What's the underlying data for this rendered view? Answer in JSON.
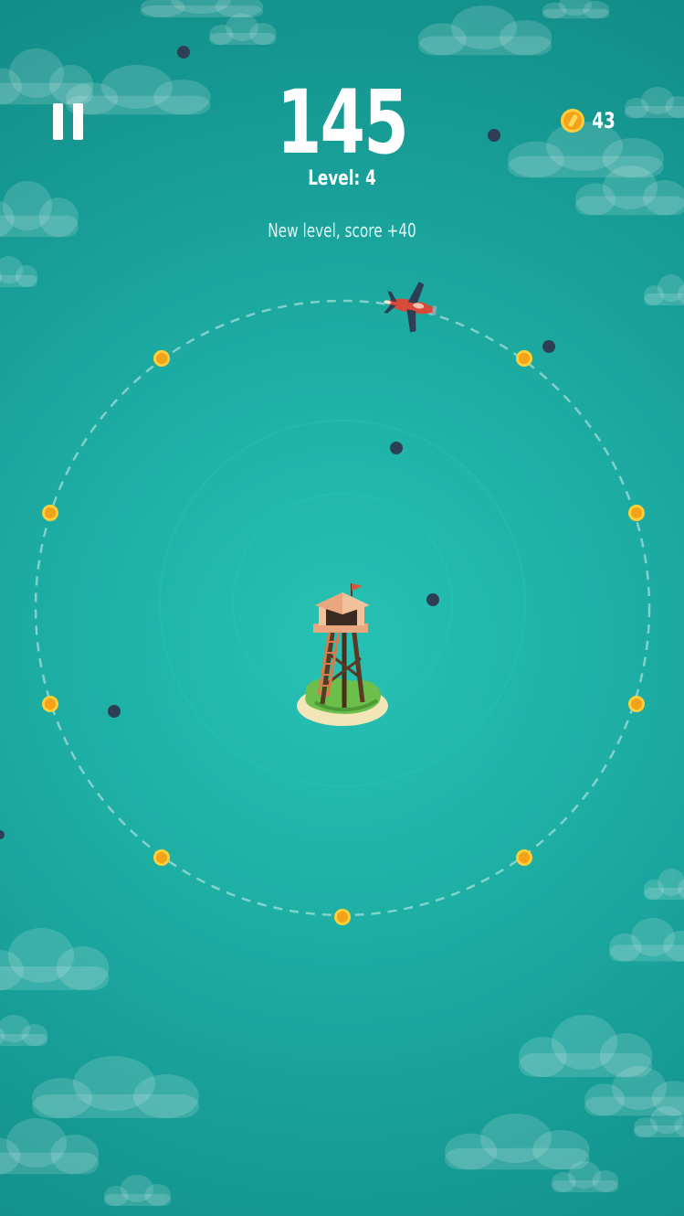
{
  "hud": {
    "score": "145",
    "level_label": "Level: 4",
    "message": "New level, score +40",
    "coins": "43"
  },
  "icons": {
    "pause": "pause-icon",
    "coin": "coin-icon",
    "plane": "plane-icon",
    "tower": "watchtower-icon",
    "cloud": "cloud-icon",
    "bomb": "bomb-icon"
  },
  "colors": {
    "sea_center": "#27c2b4",
    "sea_edge": "#128c87",
    "coin": "#f4a21a",
    "plane": "#d84b3a",
    "bomb": "#2d3f55"
  }
}
